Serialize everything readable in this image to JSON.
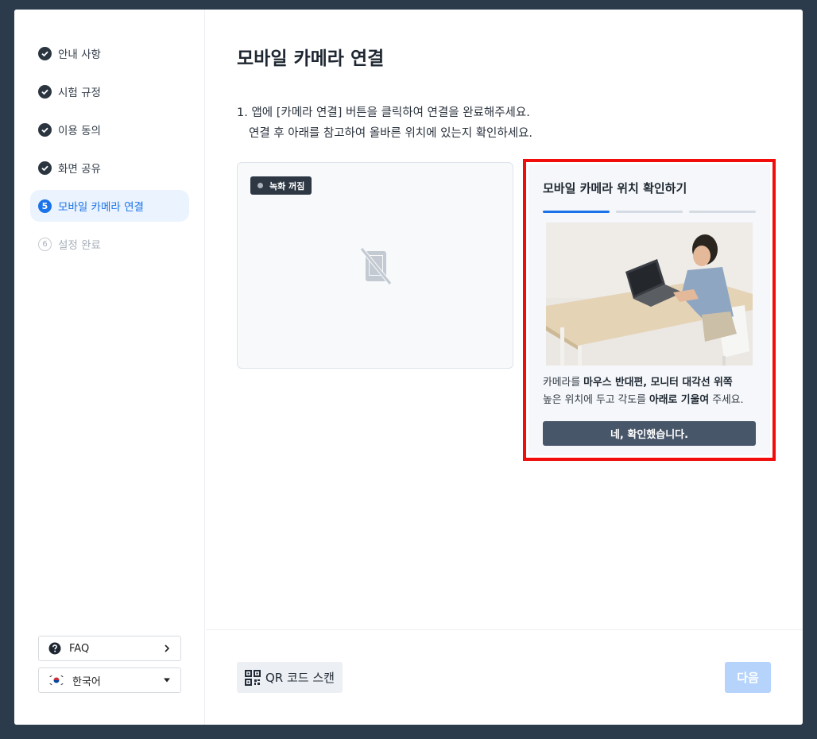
{
  "sidebar": {
    "steps": [
      {
        "label": "안내 사항",
        "status": "done"
      },
      {
        "label": "시험 규정",
        "status": "done"
      },
      {
        "label": "이용 동의",
        "status": "done"
      },
      {
        "label": "화면 공유",
        "status": "done"
      },
      {
        "label": "모바일 카메라 연결",
        "status": "current",
        "number": "5"
      },
      {
        "label": "설정 완료",
        "status": "pending",
        "number": "6"
      }
    ],
    "faq_label": "FAQ",
    "language_label": "한국어"
  },
  "main": {
    "title": "모바일 카메라 연결",
    "instruction_line1": "1. 앱에 [카메라 연결] 버튼을 클릭하여 연결을 완료해주세요.",
    "instruction_line2": "연결 후 아래를 참고하여 올바른 위치에 있는지 확인하세요.",
    "recording_badge": "녹화 꺼짐"
  },
  "guide": {
    "title": "모바일 카메라 위치 확인하기",
    "progress_step": 1,
    "progress_total": 3,
    "text": {
      "p1": "카메라를 ",
      "b1": "마우스 반대편, 모니터 대각선 위쪽",
      "p2": "높은 위치에 두고 각도를 ",
      "b2": "아래로 기울여",
      "p3": " 주세요."
    },
    "confirm_label": "네, 확인했습니다."
  },
  "footer": {
    "qr_label": "QR 코드 스캔",
    "next_label": "다음"
  },
  "colors": {
    "accent": "#1a73e8",
    "highlight_border": "#f20d0d",
    "next_disabled": "#b5d3fb"
  }
}
